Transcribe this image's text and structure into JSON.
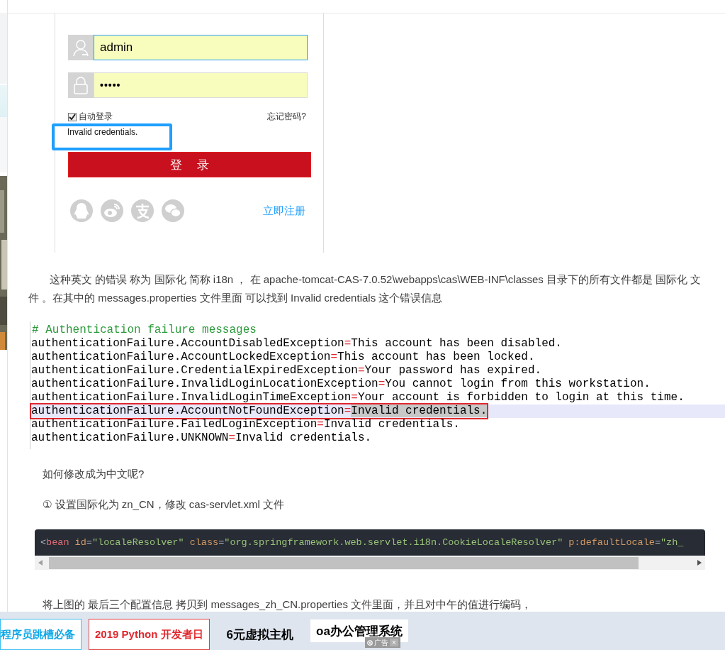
{
  "login_screenshot": {
    "username": {
      "value": "admin",
      "focused": true
    },
    "password": {
      "value": "•••••"
    },
    "remember": {
      "label": "自动登录",
      "checked": true
    },
    "forgot_link": "忘记密码?",
    "error": "Invalid credentials.",
    "login_button": "登 录",
    "register_link": "立即注册"
  },
  "paragraph_1": "这种英文 的错误 称为 国际化 简称 i18n ， 在 apache-tomcat-CAS-7.0.52\\webapps\\cas\\WEB-INF\\classes 目录下的所有文件都是 国际化 文件 。在其中的 messages.properties 文件里面 可以找到 Invalid credentials 这个错误信息",
  "properties_code": {
    "comment": "# Authentication failure messages",
    "lines": [
      {
        "text": "authenticationFailure.AccountDisabledException=This account has been disabled.",
        "selected": false
      },
      {
        "text": "authenticationFailure.AccountLockedException=This account has been locked.",
        "selected": false
      },
      {
        "text": "authenticationFailure.CredentialExpiredException=Your password has expired.",
        "selected": false
      },
      {
        "text": "authenticationFailure.InvalidLoginLocationException=You cannot login from this workstation.",
        "selected": false
      },
      {
        "text": "authenticationFailure.InvalidLoginTimeException=Your account is forbidden to login at this time.",
        "selected": false
      },
      {
        "text": "authenticationFailure.AccountNotFoundException=Invalid credentials.",
        "selected": true
      },
      {
        "text": "authenticationFailure.FailedLoginException=Invalid credentials.",
        "selected": false
      },
      {
        "text": "authenticationFailure.UNKNOWN=Invalid credentials.",
        "selected": false
      }
    ]
  },
  "paragraph_2": "如何修改成为中文呢?",
  "paragraph_3": "① 设置国际化为 zn_CN，修改 cas-servlet.xml 文件",
  "xml_code": {
    "tokens": [
      {
        "text": "<",
        "kind": "punct"
      },
      {
        "text": "bean",
        "kind": "tag"
      },
      {
        "text": " id",
        "kind": "attr"
      },
      {
        "text": "=",
        "kind": "punct"
      },
      {
        "text": "\"localeResolver\"",
        "kind": "string"
      },
      {
        "text": " class",
        "kind": "attr"
      },
      {
        "text": "=",
        "kind": "punct"
      },
      {
        "text": "\"org.springframework.web.servlet.i18n.CookieLocaleResolver\"",
        "kind": "string"
      },
      {
        "text": " p:defaultLocale",
        "kind": "attr"
      },
      {
        "text": "=",
        "kind": "punct"
      },
      {
        "text": "\"zh_",
        "kind": "string"
      }
    ]
  },
  "paragraph_4": "将上图的 最后三个配置信息 拷贝到 messages_zh_CN.properties 文件里面，并且对中午的值进行编码，",
  "ad_bar": {
    "items": [
      {
        "text": "程序员跳槽必备",
        "kind": "cyan"
      },
      {
        "text": "2019 Python 开发者日",
        "kind": "red"
      },
      {
        "text": "6元虚拟主机",
        "kind": "plain"
      },
      {
        "text": "oa办公管理系统",
        "kind": "white"
      }
    ],
    "ad_label": "广告",
    "close": "×"
  }
}
